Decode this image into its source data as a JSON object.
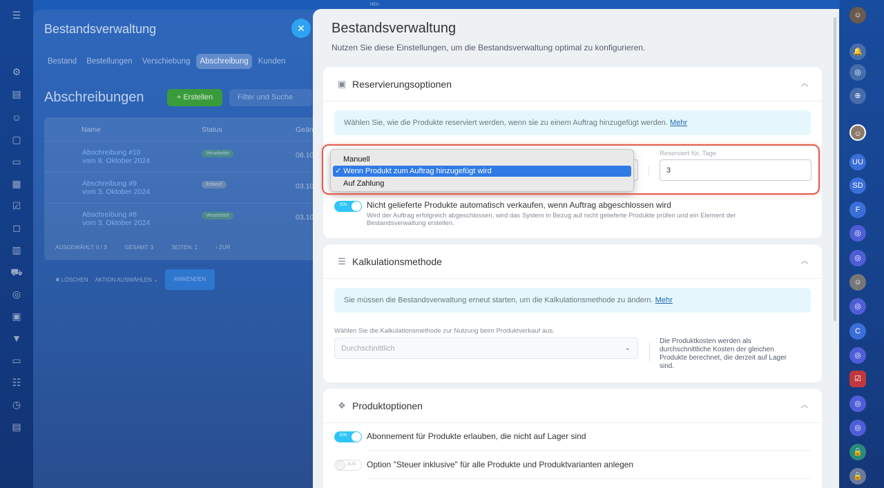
{
  "background_app": {
    "new_badge": "NEU",
    "title": "Bestandsverwaltung",
    "tabs": [
      {
        "label": "Bestand",
        "active": false
      },
      {
        "label": "Bestellungen",
        "active": false
      },
      {
        "label": "Verschiebung",
        "active": false
      },
      {
        "label": "Abschreibung",
        "active": true
      },
      {
        "label": "Kunden",
        "active": false
      }
    ],
    "heading": "Abschreibungen",
    "create_label": "+ Erstellen",
    "filter_placeholder": "Filter und Suche",
    "columns": [
      "Name",
      "Status",
      "Geän"
    ],
    "rows": [
      {
        "name": "Abschreibung #10",
        "date_line": "vom 8. Oktober 2024",
        "status": "Verarbeitet",
        "changed": "08.10"
      },
      {
        "name": "Abschreibung #9",
        "date_line": "vom 3. Oktober 2024",
        "status": "Entwurf",
        "changed": "03.10"
      },
      {
        "name": "Abschreibung #8",
        "date_line": "vom 3. Oktober 2024",
        "status": "Verarbeitet",
        "changed": "03.10"
      }
    ],
    "footer": {
      "selected": "AUSGEWÄHLT: 0 / 3",
      "total": "GESAMT: 3",
      "pages": "SEITEN: 1",
      "back": "‹ ZUR"
    },
    "actions": {
      "delete": "✖ LÖSCHEN",
      "select_action": "AKTION AUSWÄHLEN ⌄",
      "apply": "ANWENDEN"
    }
  },
  "slider": {
    "title": "Bestandsverwaltung",
    "subtitle": "Nutzen Sie diese Einstellungen, um die Bestandsverwaltung optimal zu konfigurieren.",
    "reservation": {
      "title": "Reservierungsoptionen",
      "info": "Wählen Sie, wie die Produkte reserviert werden, wenn sie zu einem Auftrag hinzugefügt werden.",
      "more": "Mehr",
      "dropdown_options": [
        {
          "label": "Manuell",
          "selected": false
        },
        {
          "label": "Wenn Produkt zum Auftrag hinzugefügt wird",
          "selected": true
        },
        {
          "label": "Auf Zahlung",
          "selected": false
        }
      ],
      "reserved_label": "Reserviert für, Tage",
      "reserved_value": "3",
      "auto_sell_toggle": "EIN",
      "auto_sell_label": "Nicht gelieferte Produkte automatisch verkaufen, wenn Auftrag abgeschlossen wird",
      "auto_sell_desc_1": "Wird der Auftrag erfolgreich abgeschlossen, wird das System in Bezug auf nicht gelieferte Produkte prüfen und ein Element der",
      "auto_sell_desc_2": "Bestandsverwaltung erstellen."
    },
    "calculation": {
      "title": "Kalkulationsmethode",
      "info": "Sie müssen die Bestandsverwaltung erneut starten, um die Kalkulationsmethode zu ändern.",
      "more": "Mehr",
      "select_label": "Wählen Sie die Kalkulationsmethode zur Nutzung beim Produktverkauf aus.",
      "select_value": "Durchschnittlich",
      "hint_1": "Die Produktkosten werden als",
      "hint_2": "durchschnittliche Kosten der gleichen",
      "hint_3": "Produkte berechnet, die derzeit auf Lager",
      "hint_4": "sind."
    },
    "product_options": {
      "title": "Produktoptionen",
      "toggle1_state": "EIN",
      "toggle1_label": "Abonnement für Produkte erlauben, die nicht auf Lager sind",
      "toggle2_state": "AUS",
      "toggle2_label": "Option \"Steuer inklusive\" für alle Produkte und Produktvarianten anlegen"
    }
  },
  "right_rail_avatar_letters": [
    "UU",
    "SD",
    "F",
    "C"
  ]
}
